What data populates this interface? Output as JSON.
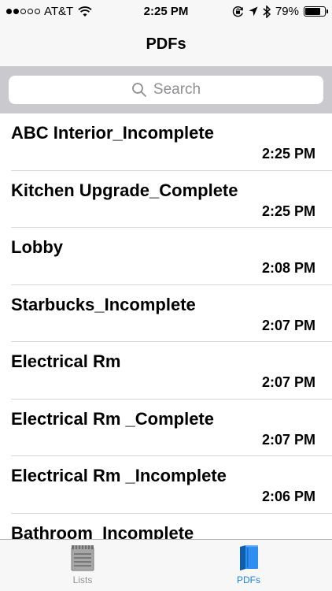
{
  "status_bar": {
    "carrier": "AT&T",
    "time": "2:25 PM",
    "battery_percent": "79%",
    "battery_level": 0.79,
    "signal_bars_filled": 2,
    "signal_bars_total": 5,
    "icons": [
      "wifi-icon",
      "orientation-lock-icon",
      "location-arrow-icon",
      "bluetooth-icon",
      "battery-icon"
    ]
  },
  "nav": {
    "title": "PDFs"
  },
  "search": {
    "placeholder": "Search"
  },
  "pdfs": [
    {
      "name": "ABC Interior_Incomplete",
      "time": "2:25 PM"
    },
    {
      "name": "Kitchen Upgrade_Complete",
      "time": "2:25 PM"
    },
    {
      "name": "Lobby",
      "time": "2:08 PM"
    },
    {
      "name": "Starbucks_Incomplete",
      "time": "2:07 PM"
    },
    {
      "name": "Electrical Rm",
      "time": "2:07 PM"
    },
    {
      "name": "Electrical Rm _Complete",
      "time": "2:07 PM"
    },
    {
      "name": "Electrical Rm _Incomplete",
      "time": "2:06 PM"
    },
    {
      "name": "Bathroom_Incomplete",
      "time": ""
    }
  ],
  "tabs": [
    {
      "label": "Lists",
      "icon": "notepad-icon",
      "selected": false,
      "color": "#929292"
    },
    {
      "label": "PDFs",
      "icon": "books-icon",
      "selected": true,
      "color": "#1a82e0"
    }
  ],
  "colors": {
    "accent": "#1a82e0",
    "search_background": "#c9c9ce",
    "bar_background": "#f7f7f7",
    "inactive_tab": "#929292"
  }
}
